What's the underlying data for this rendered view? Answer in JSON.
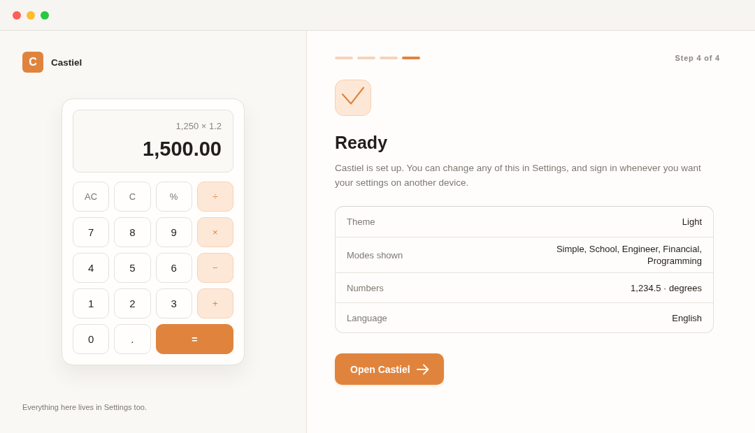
{
  "sidebar": {
    "logo_letter": "C",
    "app_name": "Castiel",
    "calculator": {
      "expression": "1,250 × 1.2",
      "result": "1,500.00",
      "keys": [
        {
          "label": "AC",
          "kind": "function"
        },
        {
          "label": "C",
          "kind": "function"
        },
        {
          "label": "%",
          "kind": "function"
        },
        {
          "label": "÷",
          "kind": "operator"
        },
        {
          "label": "7",
          "kind": "digit"
        },
        {
          "label": "8",
          "kind": "digit"
        },
        {
          "label": "9",
          "kind": "digit"
        },
        {
          "label": "×",
          "kind": "operator"
        },
        {
          "label": "4",
          "kind": "digit"
        },
        {
          "label": "5",
          "kind": "digit"
        },
        {
          "label": "6",
          "kind": "digit"
        },
        {
          "label": "−",
          "kind": "operator"
        },
        {
          "label": "1",
          "kind": "digit"
        },
        {
          "label": "2",
          "kind": "digit"
        },
        {
          "label": "3",
          "kind": "digit"
        },
        {
          "label": "+",
          "kind": "operator"
        },
        {
          "label": "0",
          "kind": "digit"
        },
        {
          "label": ".",
          "kind": "digit"
        },
        {
          "label": "=",
          "kind": "equals"
        }
      ]
    },
    "footer": "Everything here lives in Settings too."
  },
  "main": {
    "progress": {
      "steps": [
        {
          "selected": false
        },
        {
          "selected": false
        },
        {
          "selected": false
        },
        {
          "selected": true
        }
      ],
      "label": "Step 4 of 4"
    },
    "title": "Ready",
    "description": "Castiel is set up. You can change any of this in Settings, and sign in whenever you want your settings on another device.",
    "summary": [
      {
        "label": "Theme",
        "value": "Light"
      },
      {
        "label": "Modes shown",
        "value": "Simple, School, Engineer, Financial, Programming"
      },
      {
        "label": "Numbers",
        "value": "1,234.5 · degrees"
      },
      {
        "label": "Language",
        "value": "English"
      }
    ],
    "button": {
      "label": "Open Castiel"
    }
  }
}
